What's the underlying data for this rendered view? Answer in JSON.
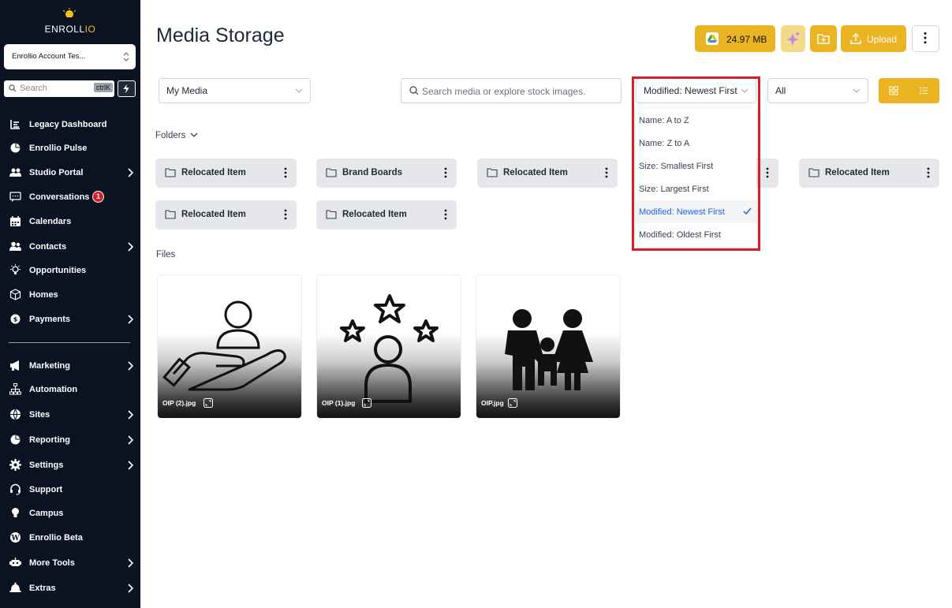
{
  "colors": {
    "sidebar_bg": "#0b1222",
    "accent": "#eab422",
    "badge": "#d32027",
    "selected_text": "#2563eb",
    "highlight_border": "#d51f26"
  },
  "sidebar": {
    "logo": {
      "main": "ENROLL",
      "accent": "IO"
    },
    "account": "Enrollio Account Tes...",
    "search": {
      "placeholder": "Search",
      "shortcut": "ctrlK"
    },
    "items": [
      {
        "label": "Legacy Dashboard",
        "icon": "dashboard-icon",
        "caret": false
      },
      {
        "label": "Enrollio Pulse",
        "icon": "pie-chart-icon",
        "caret": false
      },
      {
        "label": "Studio Portal",
        "icon": "users-icon",
        "caret": true
      },
      {
        "label": "Conversations",
        "icon": "chat-icon",
        "caret": false,
        "badge": "1"
      },
      {
        "label": "Calendars",
        "icon": "calendar-icon",
        "caret": false
      },
      {
        "label": "Contacts",
        "icon": "contacts-icon",
        "caret": true
      },
      {
        "label": "Opportunities",
        "icon": "lightbulb-icon",
        "caret": false
      },
      {
        "label": "Homes",
        "icon": "cube-icon",
        "caret": false
      },
      {
        "label": "Payments",
        "icon": "payments-icon",
        "caret": true
      },
      {
        "label": "Marketing",
        "icon": "megaphone-icon",
        "caret": true
      },
      {
        "label": "Automation",
        "icon": "sitemap-icon",
        "caret": false
      },
      {
        "label": "Sites",
        "icon": "globe-icon",
        "caret": true
      },
      {
        "label": "Reporting",
        "icon": "pie-chart-icon",
        "caret": true
      },
      {
        "label": "Settings",
        "icon": "gear-icon",
        "caret": true
      },
      {
        "label": "Support",
        "icon": "headset-icon",
        "caret": false
      },
      {
        "label": "Campus",
        "icon": "bulb-icon",
        "caret": false
      },
      {
        "label": "Enrollio Beta",
        "icon": "wordpress-icon",
        "caret": false
      },
      {
        "label": "More Tools",
        "icon": "robot-icon",
        "caret": true
      },
      {
        "label": "Extras",
        "icon": "bell-icon",
        "caret": true
      }
    ]
  },
  "header": {
    "title": "Media Storage",
    "storage": "24.97 MB",
    "upload_label": "Upload"
  },
  "filters": {
    "media_type": "My Media",
    "search_placeholder": "Search media or explore stock images.",
    "sort_selected": "Modified: Newest First",
    "type_filter": "All"
  },
  "sort_options": [
    {
      "label": "Name: A to Z",
      "selected": false
    },
    {
      "label": "Name: Z to A",
      "selected": false
    },
    {
      "label": "Size: Smallest First",
      "selected": false
    },
    {
      "label": "Size: Largest First",
      "selected": false
    },
    {
      "label": "Modified: Newest First",
      "selected": true
    },
    {
      "label": "Modified: Oldest First",
      "selected": false
    }
  ],
  "folders_label": "Folders",
  "folders": [
    {
      "name": "Relocated Item"
    },
    {
      "name": "Brand Boards"
    },
    {
      "name": "Relocated Item"
    },
    {
      "name": ""
    },
    {
      "name": "Relocated Item"
    },
    {
      "name": "Relocated Item"
    },
    {
      "name": "Relocated Item"
    }
  ],
  "files_label": "Files",
  "files": [
    {
      "name": "OIP (2).jpg",
      "icon": "hand-person-icon"
    },
    {
      "name": "OIP (1).jpg",
      "icon": "person-stars-icon"
    },
    {
      "name": "OIP.jpg",
      "icon": "family-icon"
    }
  ]
}
